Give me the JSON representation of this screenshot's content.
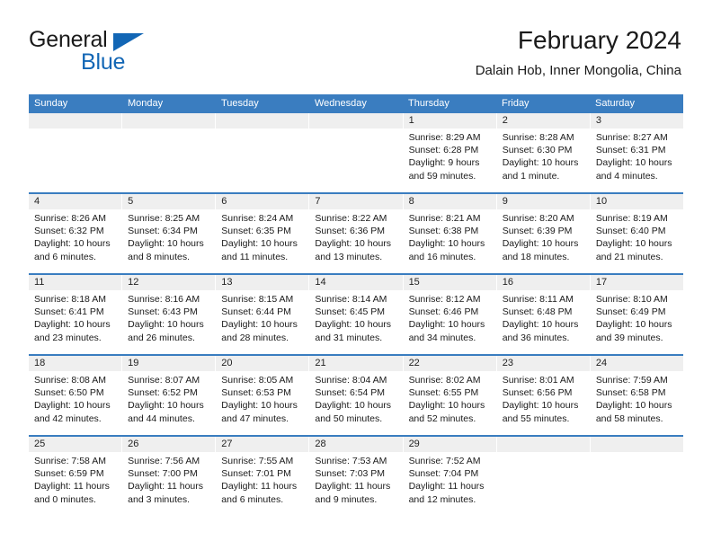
{
  "brand": {
    "name_top": "General",
    "name_bottom": "Blue",
    "accent_color": "#1266b5"
  },
  "header": {
    "title": "February 2024",
    "subtitle": "Dalain Hob, Inner Mongolia, China"
  },
  "theme": {
    "header_row_bg": "#3a7dc0",
    "day_band_bg": "#efefef",
    "text_color": "#1a1a1a"
  },
  "calendar": {
    "weekdays": [
      "Sunday",
      "Monday",
      "Tuesday",
      "Wednesday",
      "Thursday",
      "Friday",
      "Saturday"
    ],
    "weeks": [
      [
        {
          "day": "",
          "lines": []
        },
        {
          "day": "",
          "lines": []
        },
        {
          "day": "",
          "lines": []
        },
        {
          "day": "",
          "lines": []
        },
        {
          "day": "1",
          "lines": [
            "Sunrise: 8:29 AM",
            "Sunset: 6:28 PM",
            "Daylight: 9 hours",
            "and 59 minutes."
          ]
        },
        {
          "day": "2",
          "lines": [
            "Sunrise: 8:28 AM",
            "Sunset: 6:30 PM",
            "Daylight: 10 hours",
            "and 1 minute."
          ]
        },
        {
          "day": "3",
          "lines": [
            "Sunrise: 8:27 AM",
            "Sunset: 6:31 PM",
            "Daylight: 10 hours",
            "and 4 minutes."
          ]
        }
      ],
      [
        {
          "day": "4",
          "lines": [
            "Sunrise: 8:26 AM",
            "Sunset: 6:32 PM",
            "Daylight: 10 hours",
            "and 6 minutes."
          ]
        },
        {
          "day": "5",
          "lines": [
            "Sunrise: 8:25 AM",
            "Sunset: 6:34 PM",
            "Daylight: 10 hours",
            "and 8 minutes."
          ]
        },
        {
          "day": "6",
          "lines": [
            "Sunrise: 8:24 AM",
            "Sunset: 6:35 PM",
            "Daylight: 10 hours",
            "and 11 minutes."
          ]
        },
        {
          "day": "7",
          "lines": [
            "Sunrise: 8:22 AM",
            "Sunset: 6:36 PM",
            "Daylight: 10 hours",
            "and 13 minutes."
          ]
        },
        {
          "day": "8",
          "lines": [
            "Sunrise: 8:21 AM",
            "Sunset: 6:38 PM",
            "Daylight: 10 hours",
            "and 16 minutes."
          ]
        },
        {
          "day": "9",
          "lines": [
            "Sunrise: 8:20 AM",
            "Sunset: 6:39 PM",
            "Daylight: 10 hours",
            "and 18 minutes."
          ]
        },
        {
          "day": "10",
          "lines": [
            "Sunrise: 8:19 AM",
            "Sunset: 6:40 PM",
            "Daylight: 10 hours",
            "and 21 minutes."
          ]
        }
      ],
      [
        {
          "day": "11",
          "lines": [
            "Sunrise: 8:18 AM",
            "Sunset: 6:41 PM",
            "Daylight: 10 hours",
            "and 23 minutes."
          ]
        },
        {
          "day": "12",
          "lines": [
            "Sunrise: 8:16 AM",
            "Sunset: 6:43 PM",
            "Daylight: 10 hours",
            "and 26 minutes."
          ]
        },
        {
          "day": "13",
          "lines": [
            "Sunrise: 8:15 AM",
            "Sunset: 6:44 PM",
            "Daylight: 10 hours",
            "and 28 minutes."
          ]
        },
        {
          "day": "14",
          "lines": [
            "Sunrise: 8:14 AM",
            "Sunset: 6:45 PM",
            "Daylight: 10 hours",
            "and 31 minutes."
          ]
        },
        {
          "day": "15",
          "lines": [
            "Sunrise: 8:12 AM",
            "Sunset: 6:46 PM",
            "Daylight: 10 hours",
            "and 34 minutes."
          ]
        },
        {
          "day": "16",
          "lines": [
            "Sunrise: 8:11 AM",
            "Sunset: 6:48 PM",
            "Daylight: 10 hours",
            "and 36 minutes."
          ]
        },
        {
          "day": "17",
          "lines": [
            "Sunrise: 8:10 AM",
            "Sunset: 6:49 PM",
            "Daylight: 10 hours",
            "and 39 minutes."
          ]
        }
      ],
      [
        {
          "day": "18",
          "lines": [
            "Sunrise: 8:08 AM",
            "Sunset: 6:50 PM",
            "Daylight: 10 hours",
            "and 42 minutes."
          ]
        },
        {
          "day": "19",
          "lines": [
            "Sunrise: 8:07 AM",
            "Sunset: 6:52 PM",
            "Daylight: 10 hours",
            "and 44 minutes."
          ]
        },
        {
          "day": "20",
          "lines": [
            "Sunrise: 8:05 AM",
            "Sunset: 6:53 PM",
            "Daylight: 10 hours",
            "and 47 minutes."
          ]
        },
        {
          "day": "21",
          "lines": [
            "Sunrise: 8:04 AM",
            "Sunset: 6:54 PM",
            "Daylight: 10 hours",
            "and 50 minutes."
          ]
        },
        {
          "day": "22",
          "lines": [
            "Sunrise: 8:02 AM",
            "Sunset: 6:55 PM",
            "Daylight: 10 hours",
            "and 52 minutes."
          ]
        },
        {
          "day": "23",
          "lines": [
            "Sunrise: 8:01 AM",
            "Sunset: 6:56 PM",
            "Daylight: 10 hours",
            "and 55 minutes."
          ]
        },
        {
          "day": "24",
          "lines": [
            "Sunrise: 7:59 AM",
            "Sunset: 6:58 PM",
            "Daylight: 10 hours",
            "and 58 minutes."
          ]
        }
      ],
      [
        {
          "day": "25",
          "lines": [
            "Sunrise: 7:58 AM",
            "Sunset: 6:59 PM",
            "Daylight: 11 hours",
            "and 0 minutes."
          ]
        },
        {
          "day": "26",
          "lines": [
            "Sunrise: 7:56 AM",
            "Sunset: 7:00 PM",
            "Daylight: 11 hours",
            "and 3 minutes."
          ]
        },
        {
          "day": "27",
          "lines": [
            "Sunrise: 7:55 AM",
            "Sunset: 7:01 PM",
            "Daylight: 11 hours",
            "and 6 minutes."
          ]
        },
        {
          "day": "28",
          "lines": [
            "Sunrise: 7:53 AM",
            "Sunset: 7:03 PM",
            "Daylight: 11 hours",
            "and 9 minutes."
          ]
        },
        {
          "day": "29",
          "lines": [
            "Sunrise: 7:52 AM",
            "Sunset: 7:04 PM",
            "Daylight: 11 hours",
            "and 12 minutes."
          ]
        },
        {
          "day": "",
          "lines": []
        },
        {
          "day": "",
          "lines": []
        }
      ]
    ]
  }
}
